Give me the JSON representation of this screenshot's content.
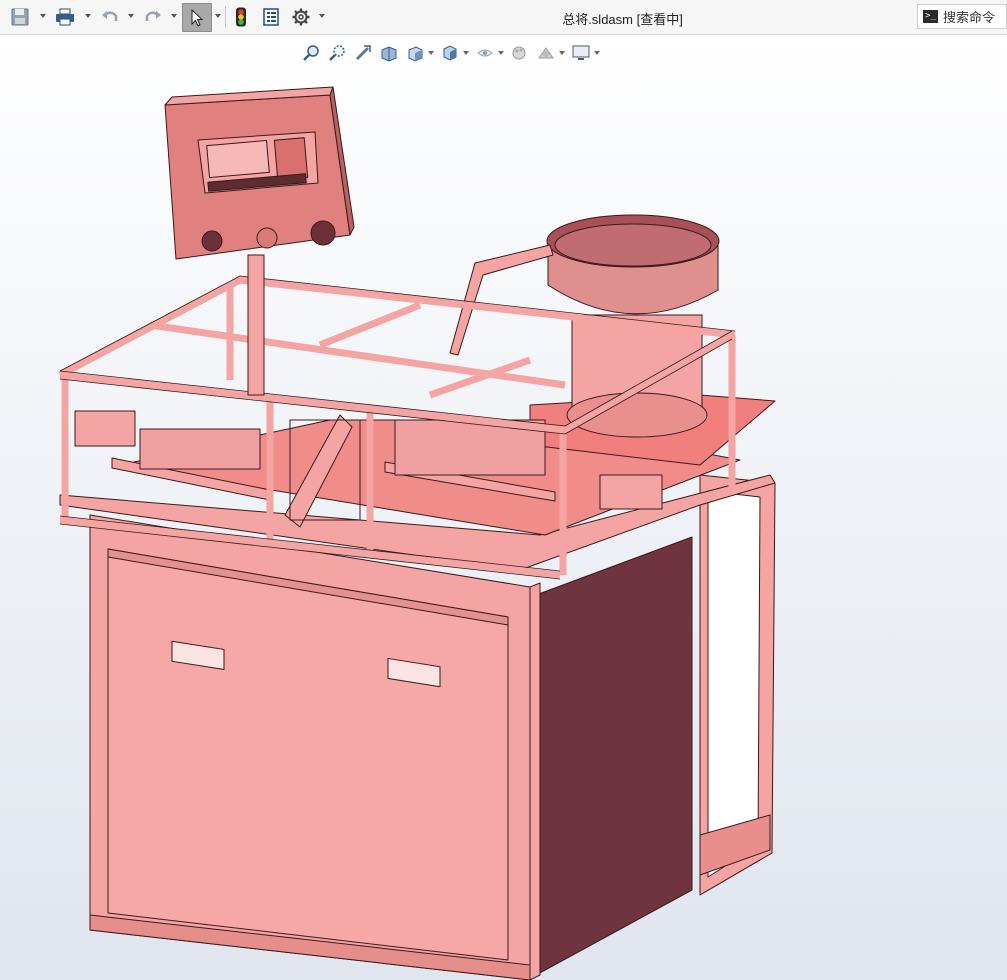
{
  "titlebar": {
    "document_title": "总将.sldasm [查看中]",
    "search_label": "搜索命令",
    "toolbar_icons": [
      "save-icon",
      "print-icon",
      "undo-icon",
      "redo-icon",
      "select-arrow-icon",
      "traffic-light-icon",
      "file-properties-icon",
      "options-gear-icon"
    ]
  },
  "heads_up_toolbar": {
    "icons": [
      "zoom-to-fit-icon",
      "zoom-to-area-icon",
      "previous-view-icon",
      "section-view-icon",
      "view-orientation-icon",
      "display-style-icon",
      "hide-show-items-icon",
      "edit-appearance-icon",
      "apply-scene-icon",
      "view-settings-icon"
    ]
  },
  "model": {
    "name": "automatic assembly machine",
    "body_color": "#f4a4a2",
    "shadow_color": "#6f3440",
    "edge_color": "#3a1a1a"
  },
  "colors": {
    "viewport_top": "#ffffff",
    "viewport_bottom": "#e0e5ee",
    "toolbar_bg": "#f6f6f6"
  }
}
